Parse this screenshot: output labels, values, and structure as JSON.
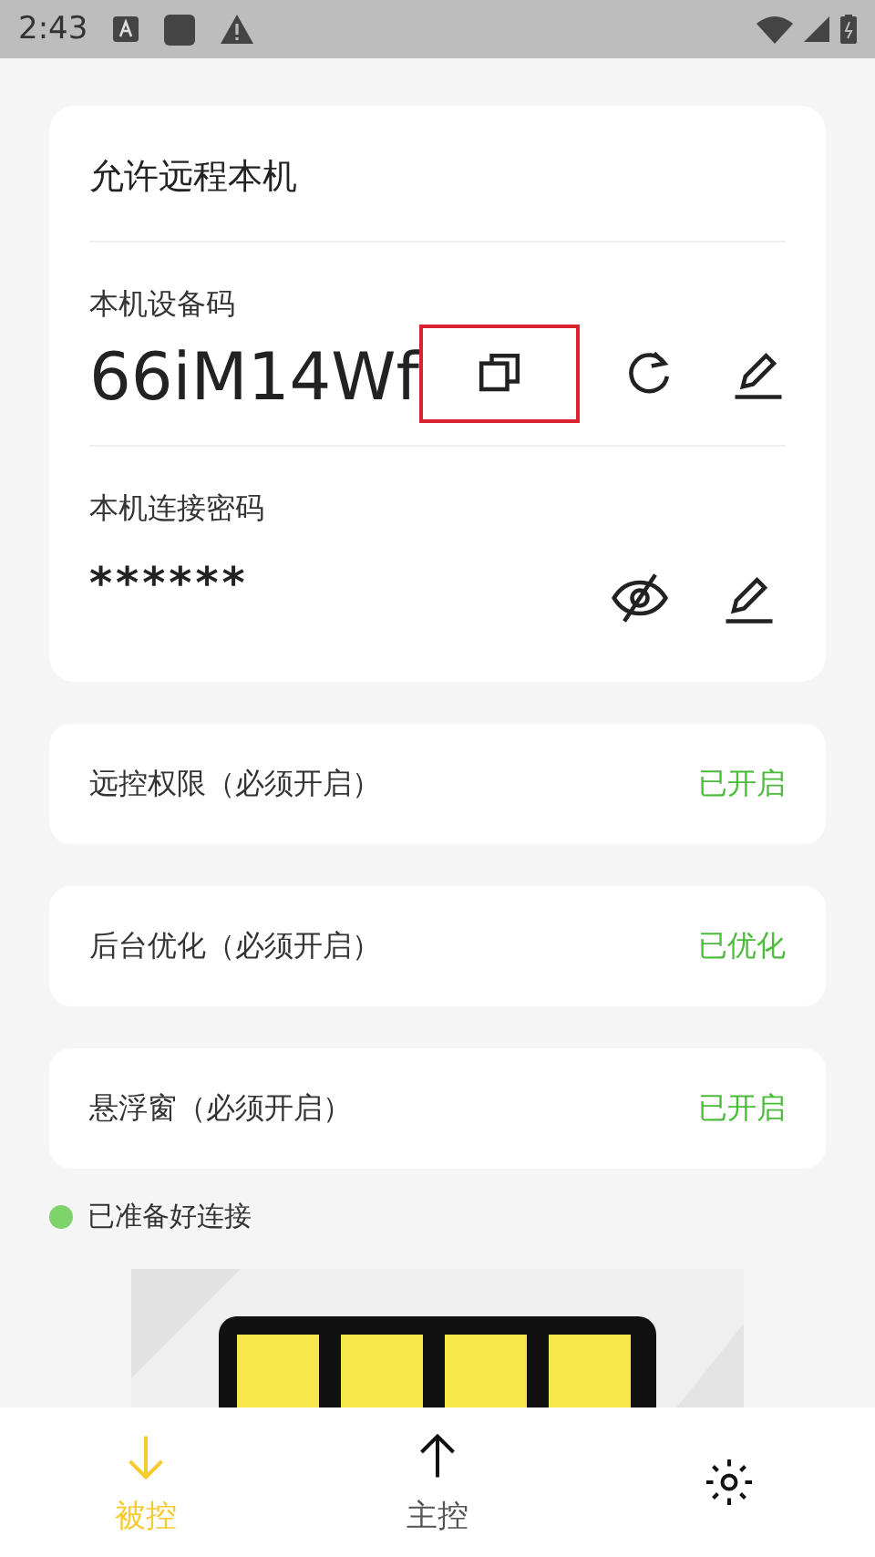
{
  "status_bar": {
    "time": "2:43"
  },
  "device_card": {
    "title": "允许远程本机",
    "code_label": "本机设备码",
    "code": "66iM14Wf",
    "code_actions": [
      {
        "kind": "copy",
        "highlighted": true
      },
      {
        "kind": "refresh",
        "highlighted": false
      },
      {
        "kind": "edit",
        "highlighted": false
      }
    ],
    "password_label": "本机连接密码",
    "password": "******",
    "password_actions": [
      {
        "kind": "hide",
        "highlighted": false
      },
      {
        "kind": "edit",
        "highlighted": false
      }
    ]
  },
  "settings": [
    {
      "label": "远控权限（必须开启）",
      "value": "已开启"
    },
    {
      "label": "后台优化（必须开启）",
      "value": "已优化"
    },
    {
      "label": "悬浮窗（必须开启）",
      "value": "已开启"
    }
  ],
  "ready": {
    "text": "已准备好连接",
    "color": "#7ed36a"
  },
  "tabs": [
    {
      "label": "被控",
      "kind": "down",
      "selected": true
    },
    {
      "label": "主控",
      "kind": "up",
      "selected": false
    },
    {
      "kind": "gear",
      "selected": false
    }
  ]
}
